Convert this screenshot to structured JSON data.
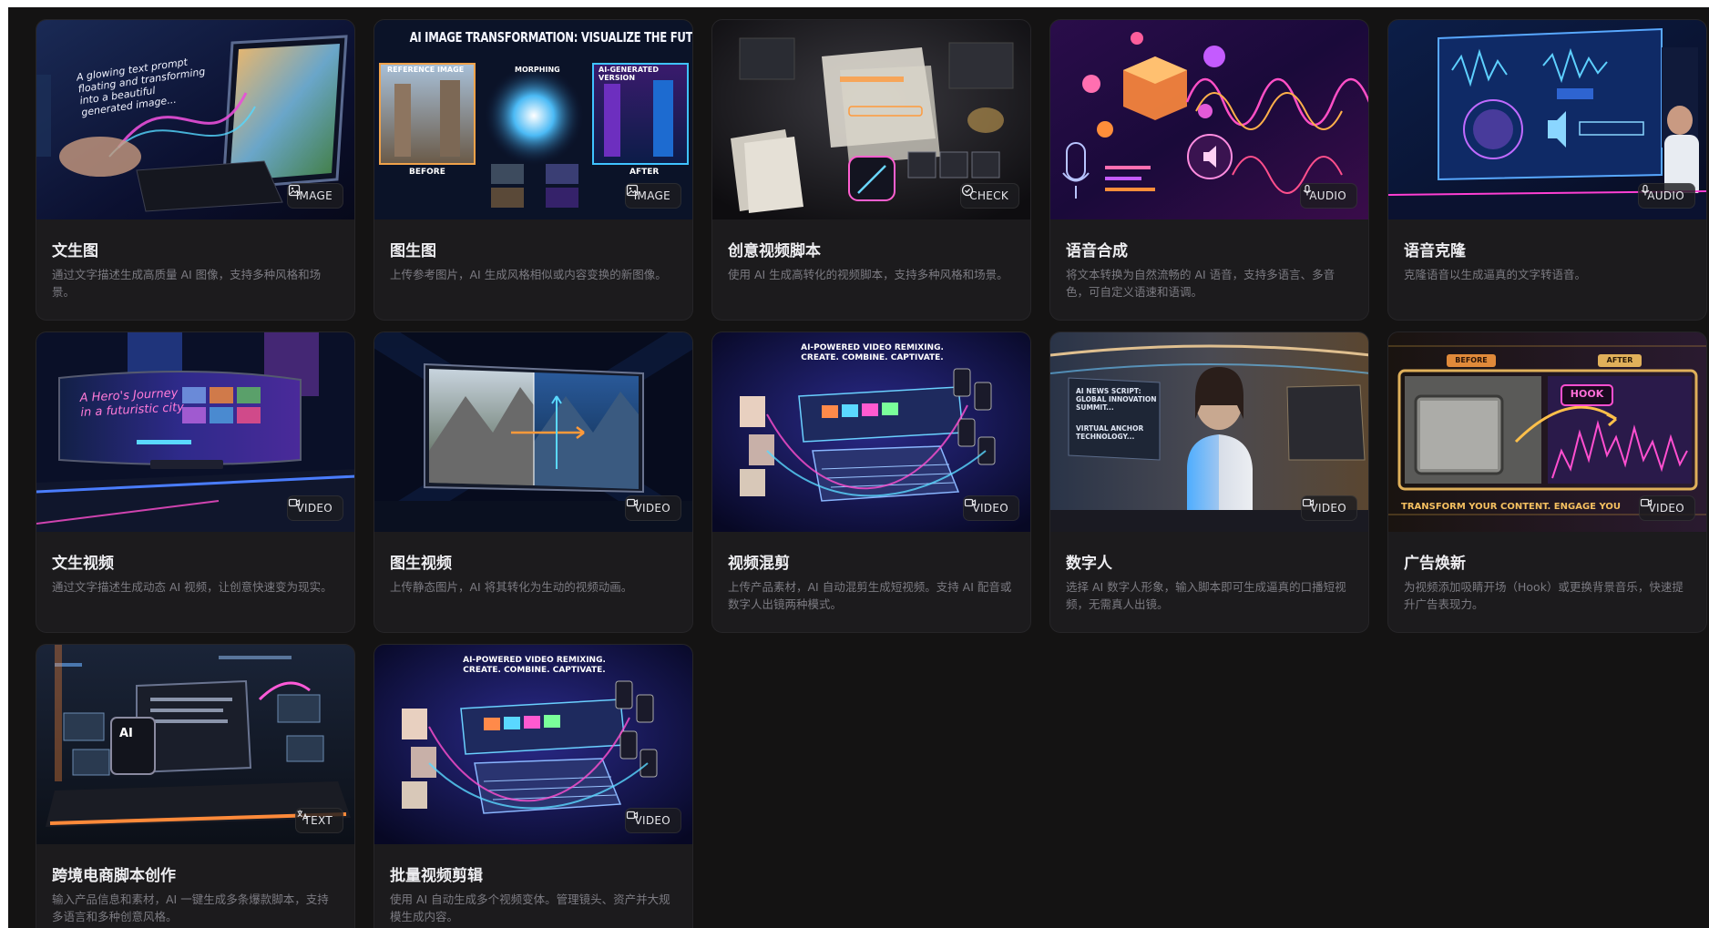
{
  "cards": [
    {
      "title": "文生图",
      "desc": "通过文字描述生成高质量 AI 图像，支持多种风格和场景。",
      "badge": "IMAGE",
      "badge_icon": "image-icon",
      "overlay": [
        "A glowing text prompt",
        "floating and transforming",
        "into a beautiful",
        "generated image..."
      ]
    },
    {
      "title": "图生图",
      "desc": "上传参考图片，AI 生成风格相似或内容变换的新图像。",
      "badge": "IMAGE",
      "badge_icon": "image-icon",
      "overlay": [
        "AI IMAGE TRANSFORMATION: VISUALIZE THE FUTURE",
        "REFERENCE IMAGE",
        "MORPHING",
        "AI-GENERATED VERSION",
        "BEFORE",
        "AFTER"
      ]
    },
    {
      "title": "创意视频脚本",
      "desc": "使用 AI 生成高转化的视频脚本，支持多种风格和场景。",
      "badge": "CHECK",
      "badge_icon": "check-icon",
      "overlay": []
    },
    {
      "title": "语音合成",
      "desc": "将文本转换为自然流畅的 AI 语音，支持多语言、多音色，可自定义语速和语调。",
      "badge": "AUDIO",
      "badge_icon": "mic-icon",
      "overlay": []
    },
    {
      "title": "语音克隆",
      "desc": "克隆语音以生成逼真的文字转语音。",
      "badge": "AUDIO",
      "badge_icon": "mic-icon",
      "overlay": []
    },
    {
      "title": "文生视频",
      "desc": "通过文字描述生成动态 AI 视频，让创意快速变为现实。",
      "badge": "VIDEO",
      "badge_icon": "video-icon",
      "overlay": [
        "A Hero's Journey",
        "in a futuristic city"
      ]
    },
    {
      "title": "图生视频",
      "desc": "上传静态图片，AI 将其转化为生动的视频动画。",
      "badge": "VIDEO",
      "badge_icon": "video-icon",
      "overlay": []
    },
    {
      "title": "视频混剪",
      "desc": "上传产品素材，AI 自动混剪生成短视频。支持 AI 配音或数字人出镜两种模式。",
      "badge": "VIDEO",
      "badge_icon": "video-icon",
      "overlay": [
        "AI-POWERED VIDEO REMIXING.",
        "CREATE. COMBINE. CAPTIVATE."
      ]
    },
    {
      "title": "数字人",
      "desc": "选择 AI 数字人形象，输入脚本即可生成逼真的口播短视频，无需真人出镜。",
      "badge": "VIDEO",
      "badge_icon": "video-icon",
      "overlay": [
        "AI NEWS SCRIPT:",
        "GLOBAL INNOVATION",
        "SUMMIT...",
        "VIRTUAL ANCHOR",
        "TECHNOLOGY..."
      ]
    },
    {
      "title": "广告焕新",
      "desc": "为视频添加吸睛开场（Hook）或更换背景音乐，快速提升广告表现力。",
      "badge": "VIDEO",
      "badge_icon": "video-icon",
      "overlay": [
        "BEFORE",
        "AFTER",
        "HOOK",
        "TRANSFORM YOUR CONTENT. ENGAGE YOU"
      ]
    },
    {
      "title": "跨境电商脚本创作",
      "desc": "输入产品信息和素材，AI 一键生成多条爆款脚本，支持多语言和多种创意风格。",
      "badge": "TEXT",
      "badge_icon": "translate-icon",
      "overlay": [
        "AI"
      ]
    },
    {
      "title": "批量视频剪辑",
      "desc": "使用 AI 自动生成多个视频变体。管理镜头、资产并大规模生成内容。",
      "badge": "VIDEO",
      "badge_icon": "video-icon",
      "overlay": [
        "AI-POWERED VIDEO REMIXING.",
        "CREATE. COMBINE. CAPTIVATE."
      ]
    }
  ]
}
